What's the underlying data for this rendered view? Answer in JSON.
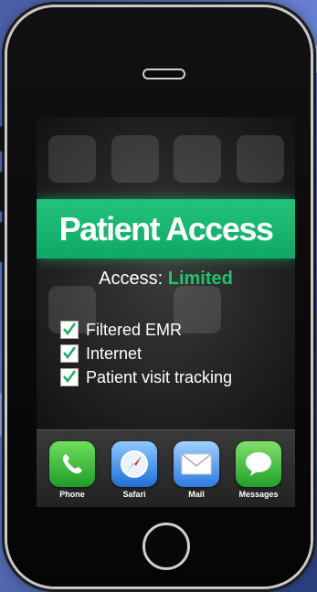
{
  "banner": {
    "title": "Patient Access"
  },
  "access": {
    "label": "Access:",
    "value": "Limited"
  },
  "features": [
    {
      "label": "Filtered EMR",
      "checked": true
    },
    {
      "label": "Internet",
      "checked": true
    },
    {
      "label": "Patient visit tracking",
      "checked": true
    }
  ],
  "dock": [
    {
      "label": "Phone",
      "icon": "phone-icon"
    },
    {
      "label": "Safari",
      "icon": "safari-icon"
    },
    {
      "label": "Mail",
      "icon": "mail-icon"
    },
    {
      "label": "Messages",
      "icon": "messages-icon"
    }
  ],
  "colors": {
    "accent_green": "#21c46e",
    "banner_green": "#17b872"
  }
}
